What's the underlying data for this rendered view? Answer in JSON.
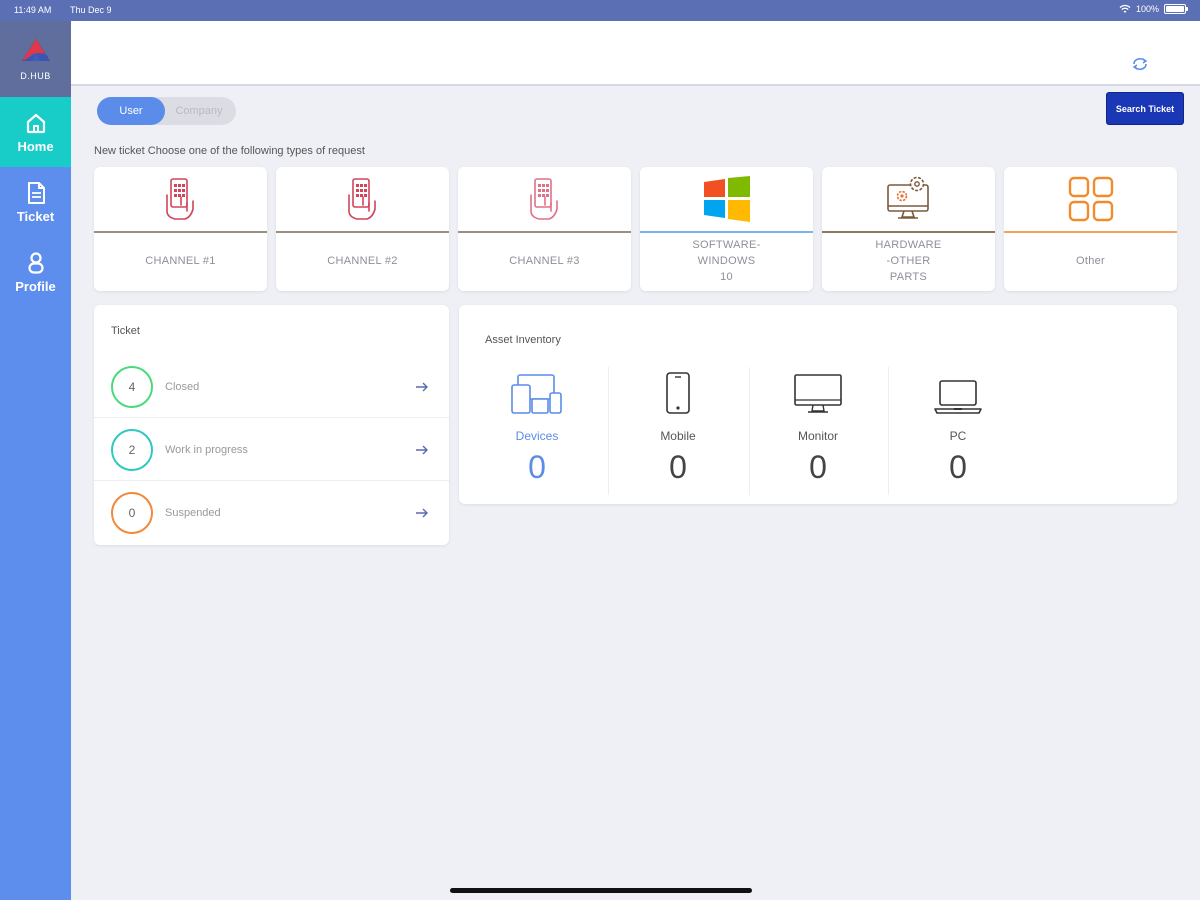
{
  "status_bar": {
    "time": "11:49 AM",
    "date": "Thu Dec 9",
    "battery": "100%"
  },
  "app": {
    "name": "D.HUB"
  },
  "sidebar": {
    "items": [
      {
        "label": "Home",
        "icon": "home-icon",
        "active": true
      },
      {
        "label": "Ticket",
        "icon": "document-icon",
        "active": false
      },
      {
        "label": "Profile",
        "icon": "user-icon",
        "active": false
      }
    ]
  },
  "header": {
    "refresh_icon": "refresh-icon"
  },
  "toggle": {
    "options": [
      "User",
      "Company"
    ],
    "selected": "User"
  },
  "search_button": "Search Ticket",
  "new_ticket_prompt": "New ticket Choose one of the following types of request",
  "request_types": [
    {
      "label": "CHANNEL #1",
      "icon": "hand-phone-icon"
    },
    {
      "label": "CHANNEL #2",
      "icon": "hand-phone-icon"
    },
    {
      "label": "CHANNEL #3",
      "icon": "hand-phone-icon"
    },
    {
      "label": "SOFTWARE-\nWINDOWS\n10",
      "icon": "windows-icon"
    },
    {
      "label": "HARDWARE\n-OTHER\nPARTS",
      "icon": "monitor-gears-icon"
    },
    {
      "label": "Other",
      "icon": "grid-icon"
    }
  ],
  "ticket_panel": {
    "title": "Ticket",
    "rows": [
      {
        "count": "4",
        "label": "Closed",
        "color": "#4cd97b"
      },
      {
        "count": "2",
        "label": "Work in progress",
        "color": "#2ec9be"
      },
      {
        "count": "0",
        "label": "Suspended",
        "color": "#f4883a"
      }
    ]
  },
  "asset_panel": {
    "title": "Asset Inventory",
    "items": [
      {
        "label": "Devices",
        "count": "0",
        "icon": "devices-icon"
      },
      {
        "label": "Mobile",
        "count": "0",
        "icon": "mobile-icon"
      },
      {
        "label": "Monitor",
        "count": "0",
        "icon": "monitor-icon"
      },
      {
        "label": "PC",
        "count": "0",
        "icon": "laptop-icon"
      }
    ]
  },
  "colors": {
    "accent": "#5b8cea",
    "active_nav": "#18ccc8",
    "search_button": "#1a37b5"
  }
}
